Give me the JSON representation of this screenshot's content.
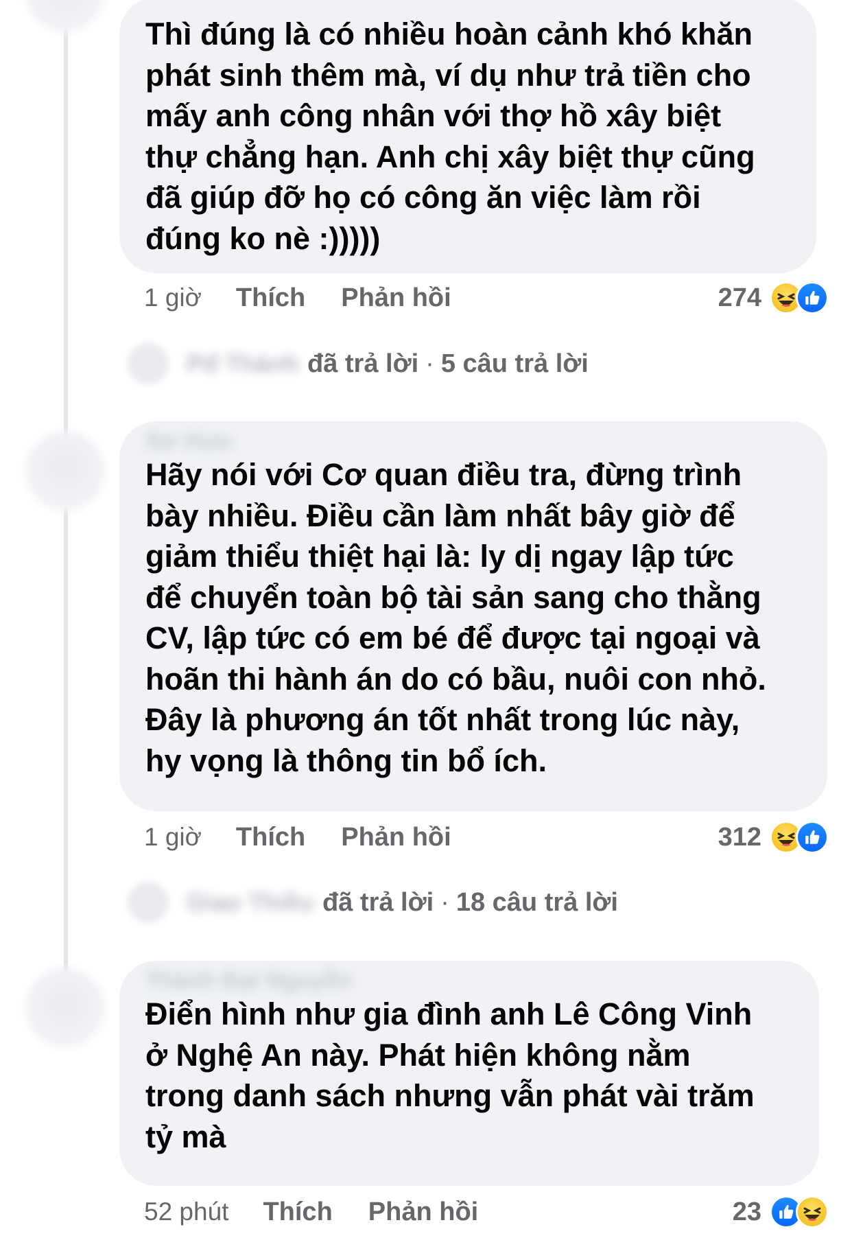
{
  "comments": [
    {
      "text": "Thì đúng là có nhiều hoàn cảnh khó khăn\nphát sinh thêm mà, ví dụ như trả tiền cho\nmấy anh công nhân với thợ hồ xây biệt\nthự chẳng hạn. Anh chị xây biệt thự cũng\nđã giúp đỡ họ có công ăn việc làm rồi\nđúng ko nè :)))))",
      "time": "1 giờ",
      "like_label": "Thích",
      "reply_label": "Phản hồi",
      "reaction_count": "274",
      "reaction_icons": [
        "haha-icon",
        "like-icon"
      ],
      "replies": {
        "replied_text": "đã trả lời",
        "separator": "·",
        "reply_count": "5 câu trả lời"
      }
    },
    {
      "text": "Hãy nói với Cơ quan điều tra, đừng trình\nbày nhiều. Điều cần làm nhất bây giờ để\ngiảm thiểu thiệt hại là: ly dị ngay lập tức\nđể chuyển toàn bộ tài sản sang cho thằng\nCV, lập tức có em bé để được tại ngoại và\nhoãn thi hành án do có bầu, nuôi con nhỏ.\nĐây là phương án tốt nhất trong lúc này,\nhy vọng là thông tin bổ ích.",
      "time": "1 giờ",
      "like_label": "Thích",
      "reply_label": "Phản hồi",
      "reaction_count": "312",
      "reaction_icons": [
        "haha-icon",
        "like-icon"
      ],
      "replies": {
        "replied_text": "đã trả lời",
        "separator": "·",
        "reply_count": "18 câu trả lời"
      }
    },
    {
      "text": "Điển hình như gia đình anh Lê Công Vinh\nở Nghệ An này. Phát hiện không nằm\ntrong danh sách nhưng vẫn phát vài trăm\ntỷ mà",
      "time": "52 phút",
      "like_label": "Thích",
      "reply_label": "Phản hồi",
      "reaction_count": "23",
      "reaction_icons": [
        "like-icon",
        "haha-icon"
      ]
    }
  ],
  "colors": {
    "bubble_bg": "#f0f2f5",
    "text": "#050505",
    "secondary_text": "#65676b",
    "like_blue": "#0866ff",
    "haha_yellow": "#f7c327"
  }
}
